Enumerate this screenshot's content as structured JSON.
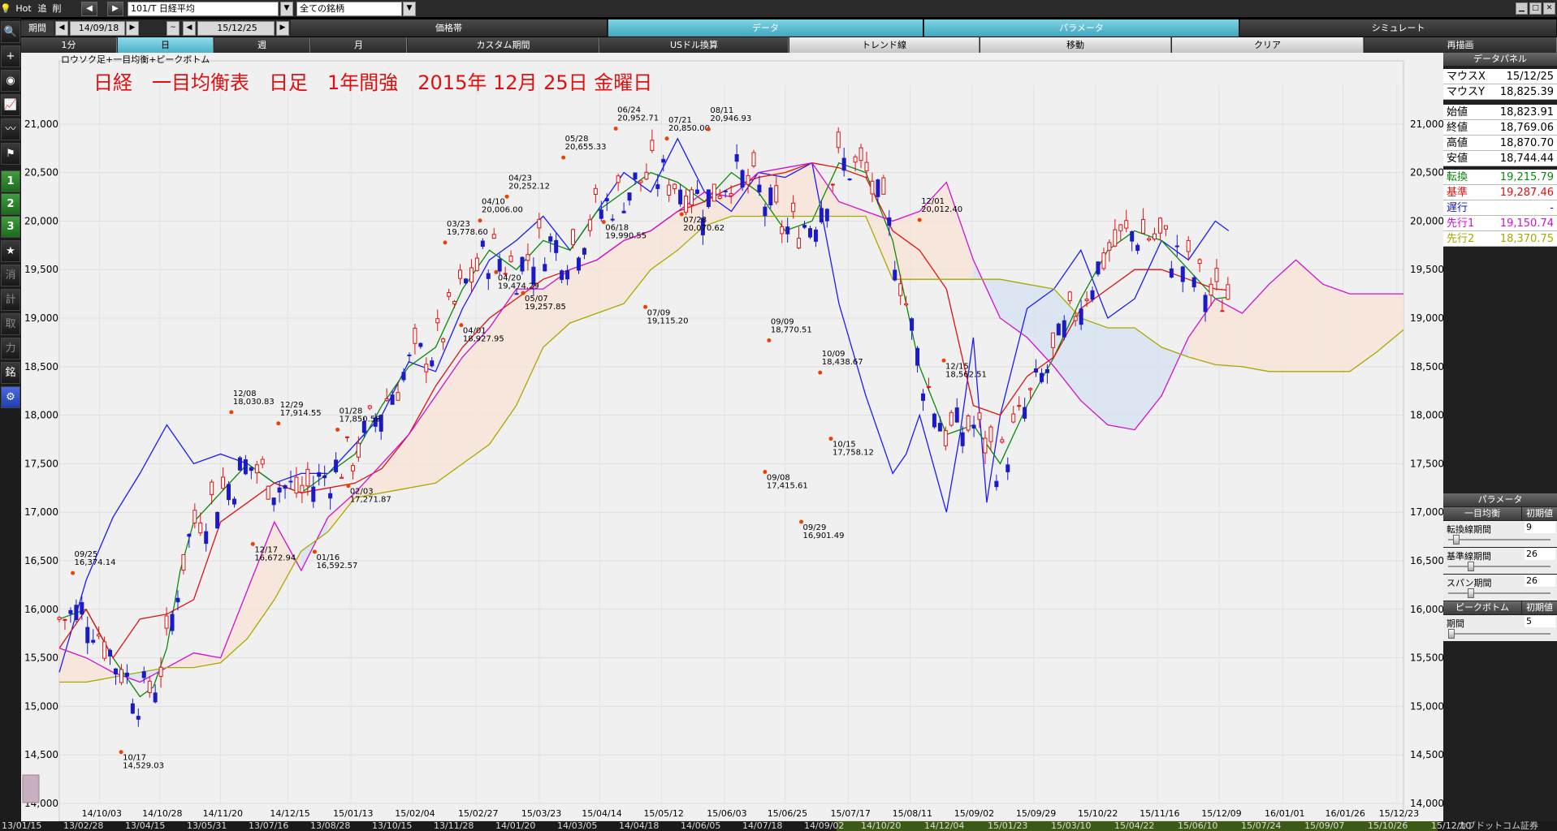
{
  "toolbar": {
    "hot": "Hot",
    "add": "追",
    "del": "削",
    "prev_icon": "◀",
    "next_icon": "▶",
    "symbol": "101/T 日経平均",
    "universe": "全ての銘柄",
    "period_label": "期間",
    "date_from": "14/09/18",
    "date_tilde": "~",
    "date_to": "15/12/25"
  },
  "tabs_row1": [
    {
      "label": "価格帯",
      "active": false
    },
    {
      "label": "データ",
      "active": true
    },
    {
      "label": "パラメータ",
      "active": true
    },
    {
      "label": "シミュレート",
      "active": false
    }
  ],
  "tabs_row2": [
    {
      "label": "1分",
      "state": "light"
    },
    {
      "label": "日",
      "state": "on"
    },
    {
      "label": "週",
      "state": "light"
    },
    {
      "label": "月",
      "state": "light"
    },
    {
      "label": "カスタム期間",
      "state": "light"
    },
    {
      "label": "USドル換算",
      "state": "light"
    },
    {
      "label": "トレンド線",
      "state": "light"
    },
    {
      "label": "移動",
      "state": "light"
    },
    {
      "label": "クリア",
      "state": "light"
    },
    {
      "label": "再描画",
      "state": "dark"
    }
  ],
  "sidebar": [
    {
      "name": "search-icon",
      "glyph": "🔍"
    },
    {
      "name": "crosshair-icon",
      "glyph": "+"
    },
    {
      "name": "camera-icon",
      "glyph": "◉"
    },
    {
      "name": "line-chart-icon",
      "glyph": "📈"
    },
    {
      "name": "multi-line-icon",
      "glyph": "〰"
    },
    {
      "name": "flag-icon",
      "glyph": "⚑"
    },
    {
      "name": "slot-1-button",
      "glyph": "1"
    },
    {
      "name": "slot-2-button",
      "glyph": "2"
    },
    {
      "name": "slot-3-button",
      "glyph": "3"
    },
    {
      "name": "star-icon",
      "glyph": "★"
    },
    {
      "name": "erase-button",
      "glyph": "消"
    },
    {
      "name": "mode-button",
      "glyph": "計"
    },
    {
      "name": "take-button",
      "glyph": "取"
    },
    {
      "name": "force-button",
      "glyph": "力"
    },
    {
      "name": "issue-button",
      "glyph": "銘"
    },
    {
      "name": "gear-icon",
      "glyph": "⚙"
    }
  ],
  "data_panel": {
    "title": "データパネル",
    "rows": [
      {
        "k": "マウスX",
        "v": "15/12/25",
        "color": "#000000"
      },
      {
        "k": "マウスY",
        "v": "18,825.39",
        "color": "#000000"
      },
      {
        "k": "始値",
        "v": "18,823.91",
        "color": "#000000"
      },
      {
        "k": "終値",
        "v": "18,769.06",
        "color": "#000000"
      },
      {
        "k": "高値",
        "v": "18,870.70",
        "color": "#000000"
      },
      {
        "k": "安値",
        "v": "18,744.44",
        "color": "#000000"
      },
      {
        "k": "転換",
        "v": "19,215.79",
        "color": "#0a8a0a"
      },
      {
        "k": "基準",
        "v": "19,287.46",
        "color": "#e01010"
      },
      {
        "k": "遅行",
        "v": "-",
        "color": "#1010e0"
      },
      {
        "k": "先行1",
        "v": "19,150.74",
        "color": "#d010d0"
      },
      {
        "k": "先行2",
        "v": "18,370.75",
        "color": "#a8a800"
      }
    ]
  },
  "params": {
    "title": "パラメータ",
    "section": "一目均衡",
    "reset": "初期値",
    "items": [
      {
        "label": "転換線期間",
        "value": "9",
        "level": 0.05
      },
      {
        "label": "基準線期間",
        "value": "26",
        "level": 0.2
      },
      {
        "label": "スパン期間",
        "value": "26",
        "level": 0.2
      }
    ],
    "section2": "ピークボトム",
    "items2": [
      {
        "label": "期間",
        "value": "5",
        "level": 0.0
      }
    ]
  },
  "bottom_dates_left": [
    "13/01/15",
    "13/02/28",
    "13/04/15",
    "13/05/31",
    "13/07/16",
    "13/08/28",
    "13/10/15",
    "13/11/28",
    "14/01/20",
    "14/03/05",
    "14/04/18",
    "14/06/05",
    "14/07/18",
    "14/09/02"
  ],
  "bottom_dates_right": [
    "14/10/20",
    "14/12/04",
    "15/01/23",
    "15/03/10",
    "15/04/22",
    "15/06/10",
    "15/07/24",
    "15/09/07",
    "15/10/26",
    "15/12/10"
  ],
  "bottom_status": "カブドットコム証券",
  "chart_data": {
    "type": "line",
    "title": "日経　一目均衡表　日足　1年間強　2015年 12月 25日 金曜日",
    "legend_text": "ロウソク足+一目均衡+ピークボトム",
    "ylim": [
      14000,
      21400
    ],
    "y_ticks": [
      14000,
      14500,
      15000,
      15500,
      16000,
      16500,
      17000,
      17500,
      18000,
      18500,
      19000,
      19500,
      20000,
      20500,
      21000
    ],
    "y_tick_labels": [
      "14,000",
      "14,500",
      "15,000",
      "15,500",
      "16,000",
      "16,500",
      "17,000",
      "17,500",
      "18,000",
      "18,500",
      "19,000",
      "19,500",
      "20,000",
      "20,500",
      "21,000"
    ],
    "x_ticks": [
      {
        "label": "14/10/03",
        "x": 0.03
      },
      {
        "label": "14/10/28",
        "x": 0.075
      },
      {
        "label": "14/11/20",
        "x": 0.12
      },
      {
        "label": "14/12/15",
        "x": 0.17
      },
      {
        "label": "15/01/13",
        "x": 0.217
      },
      {
        "label": "15/02/04",
        "x": 0.263
      },
      {
        "label": "15/02/27",
        "x": 0.31
      },
      {
        "label": "15/03/23",
        "x": 0.357
      },
      {
        "label": "15/04/14",
        "x": 0.402
      },
      {
        "label": "15/05/12",
        "x": 0.448
      },
      {
        "label": "15/06/03",
        "x": 0.495
      },
      {
        "label": "15/06/25",
        "x": 0.54
      },
      {
        "label": "15/07/17",
        "x": 0.587
      },
      {
        "label": "15/08/11",
        "x": 0.633
      },
      {
        "label": "15/09/02",
        "x": 0.679
      },
      {
        "label": "15/09/29",
        "x": 0.725
      },
      {
        "label": "15/10/22",
        "x": 0.771
      },
      {
        "label": "15/11/16",
        "x": 0.817
      },
      {
        "label": "15/12/09",
        "x": 0.863
      },
      {
        "label": "16/01/01",
        "x": 0.91
      },
      {
        "label": "16/01/26",
        "x": 0.955
      },
      {
        "label": "15/12/23",
        "x": 0.995
      }
    ],
    "series": [
      {
        "name": "遅行",
        "color": "#1a1aff",
        "x": [
          0.0,
          0.02,
          0.04,
          0.06,
          0.08,
          0.1,
          0.12,
          0.14,
          0.16,
          0.18,
          0.2,
          0.22,
          0.24,
          0.26,
          0.28,
          0.3,
          0.32,
          0.34,
          0.36,
          0.38,
          0.4,
          0.42,
          0.44,
          0.46,
          0.48,
          0.5,
          0.52,
          0.54,
          0.56,
          0.58,
          0.6,
          0.62,
          0.63,
          0.64,
          0.65,
          0.66,
          0.67,
          0.68,
          0.69,
          0.7,
          0.72,
          0.74,
          0.76,
          0.78,
          0.8,
          0.82,
          0.84,
          0.86,
          0.87
        ],
        "values": [
          15350,
          16300,
          16950,
          17400,
          17900,
          17500,
          17600,
          17500,
          17300,
          17400,
          17400,
          17700,
          18000,
          18550,
          18450,
          19100,
          19600,
          19800,
          20050,
          19700,
          20100,
          20500,
          20300,
          20850,
          20300,
          20100,
          20500,
          20450,
          20600,
          19150,
          18200,
          17400,
          17600,
          18000,
          17500,
          17000,
          17800,
          18800,
          17100,
          18000,
          19100,
          19300,
          19700,
          19000,
          19200,
          19800,
          19600,
          20000,
          19900
        ]
      },
      {
        "name": "転換",
        "color": "#0a8a0a",
        "x": [
          0.0,
          0.02,
          0.04,
          0.06,
          0.07,
          0.08,
          0.09,
          0.1,
          0.12,
          0.14,
          0.16,
          0.18,
          0.2,
          0.22,
          0.24,
          0.26,
          0.28,
          0.3,
          0.32,
          0.34,
          0.36,
          0.38,
          0.4,
          0.42,
          0.44,
          0.46,
          0.48,
          0.5,
          0.52,
          0.54,
          0.56,
          0.58,
          0.6,
          0.62,
          0.64,
          0.66,
          0.68,
          0.7,
          0.72,
          0.74,
          0.76,
          0.78,
          0.8,
          0.82,
          0.84,
          0.86,
          0.87
        ],
        "values": [
          15900,
          16000,
          15500,
          15100,
          15200,
          15600,
          16400,
          16900,
          17200,
          17500,
          17300,
          17200,
          17400,
          17600,
          18100,
          18500,
          18700,
          19300,
          19700,
          19500,
          19800,
          19700,
          20100,
          20300,
          20500,
          20400,
          20200,
          20500,
          20300,
          19900,
          20000,
          20600,
          20500,
          19800,
          18500,
          17800,
          17900,
          17500,
          18100,
          18600,
          19200,
          19700,
          19900,
          19800,
          19500,
          19200,
          19216
        ]
      },
      {
        "name": "基準",
        "color": "#e01010",
        "x": [
          0.0,
          0.02,
          0.04,
          0.06,
          0.08,
          0.1,
          0.12,
          0.14,
          0.16,
          0.18,
          0.2,
          0.22,
          0.24,
          0.26,
          0.28,
          0.3,
          0.32,
          0.34,
          0.36,
          0.38,
          0.4,
          0.42,
          0.44,
          0.46,
          0.48,
          0.5,
          0.52,
          0.54,
          0.56,
          0.58,
          0.6,
          0.62,
          0.64,
          0.66,
          0.68,
          0.7,
          0.72,
          0.74,
          0.76,
          0.78,
          0.8,
          0.82,
          0.84,
          0.86,
          0.87
        ],
        "values": [
          15600,
          16000,
          15500,
          15900,
          15950,
          16100,
          16900,
          17100,
          17300,
          17200,
          17250,
          17300,
          17450,
          17800,
          18300,
          18700,
          19000,
          19200,
          19400,
          19500,
          19600,
          19800,
          19900,
          20100,
          20200,
          20350,
          20450,
          20500,
          20600,
          20550,
          20450,
          19900,
          19700,
          19300,
          18100,
          18000,
          18400,
          18600,
          19100,
          19300,
          19500,
          19500,
          19400,
          19300,
          19287
        ]
      },
      {
        "name": "先行1",
        "color": "#d010d0",
        "x": [
          0.0,
          0.02,
          0.04,
          0.06,
          0.08,
          0.1,
          0.12,
          0.14,
          0.16,
          0.18,
          0.2,
          0.22,
          0.24,
          0.26,
          0.28,
          0.3,
          0.32,
          0.34,
          0.36,
          0.38,
          0.4,
          0.42,
          0.44,
          0.46,
          0.48,
          0.5,
          0.52,
          0.54,
          0.56,
          0.58,
          0.6,
          0.62,
          0.64,
          0.66,
          0.68,
          0.7,
          0.72,
          0.74,
          0.76,
          0.78,
          0.8,
          0.82,
          0.84,
          0.86,
          0.88,
          0.9,
          0.92,
          0.94,
          0.96,
          0.98,
          1.0
        ],
        "values": [
          15600,
          15500,
          15350,
          15250,
          15400,
          15550,
          15500,
          16200,
          16900,
          16400,
          16950,
          17200,
          17500,
          17800,
          18200,
          18600,
          18900,
          19300,
          19300,
          19500,
          19600,
          19800,
          19900,
          20100,
          20300,
          20250,
          20500,
          20550,
          20600,
          20200,
          20100,
          20000,
          20100,
          20400,
          19600,
          19000,
          18800,
          18500,
          18150,
          17900,
          17850,
          18200,
          18800,
          19200,
          19050,
          19350,
          19600,
          19350,
          19250,
          19250,
          19250
        ]
      },
      {
        "name": "先行2",
        "color": "#a8a800",
        "x": [
          0.0,
          0.02,
          0.04,
          0.06,
          0.08,
          0.1,
          0.12,
          0.14,
          0.16,
          0.18,
          0.2,
          0.22,
          0.24,
          0.26,
          0.28,
          0.3,
          0.32,
          0.34,
          0.36,
          0.38,
          0.4,
          0.42,
          0.44,
          0.46,
          0.48,
          0.5,
          0.52,
          0.54,
          0.56,
          0.58,
          0.6,
          0.62,
          0.64,
          0.66,
          0.68,
          0.7,
          0.72,
          0.74,
          0.76,
          0.78,
          0.8,
          0.82,
          0.84,
          0.86,
          0.88,
          0.9,
          0.92,
          0.94,
          0.96,
          0.98,
          1.0
        ],
        "values": [
          15250,
          15250,
          15300,
          15350,
          15400,
          15400,
          15450,
          15700,
          16100,
          16600,
          16800,
          17150,
          17200,
          17250,
          17300,
          17500,
          17700,
          18100,
          18700,
          18950,
          19050,
          19150,
          19500,
          19700,
          19950,
          20050,
          20050,
          20050,
          20050,
          20050,
          20050,
          19400,
          19400,
          19400,
          19400,
          19400,
          19350,
          19300,
          19000,
          18900,
          18900,
          18700,
          18600,
          18520,
          18500,
          18450,
          18450,
          18450,
          18450,
          18650,
          18880
        ]
      }
    ],
    "peaks": [
      {
        "label": "09/25\n16,374.14",
        "x": 0.01,
        "y": 16374,
        "up": true
      },
      {
        "label": "10/17\n14,529.03",
        "x": 0.046,
        "y": 14529,
        "up": false
      },
      {
        "label": "12/08\n18,030.83",
        "x": 0.128,
        "y": 18031,
        "up": true
      },
      {
        "label": "12/17\n16,672.94",
        "x": 0.144,
        "y": 16673,
        "up": false
      },
      {
        "label": "12/29\n17,914.55",
        "x": 0.163,
        "y": 17915,
        "up": true
      },
      {
        "label": "01/16\n16,592.57",
        "x": 0.19,
        "y": 16593,
        "up": false
      },
      {
        "label": "01/28\n17,850.58",
        "x": 0.207,
        "y": 17851,
        "up": true
      },
      {
        "label": "02/03\n17,271.87",
        "x": 0.215,
        "y": 17272,
        "up": false
      },
      {
        "label": "03/23\n19,778.60",
        "x": 0.287,
        "y": 19779,
        "up": true
      },
      {
        "label": "04/01\n18,927.95",
        "x": 0.299,
        "y": 18928,
        "up": false
      },
      {
        "label": "04/10\n20,006.00",
        "x": 0.313,
        "y": 20006,
        "up": true
      },
      {
        "label": "04/20\n19,474.29",
        "x": 0.325,
        "y": 19474,
        "up": false
      },
      {
        "label": "04/23\n20,252.12",
        "x": 0.333,
        "y": 20252,
        "up": true
      },
      {
        "label": "05/07\n19,257.85",
        "x": 0.345,
        "y": 19258,
        "up": false
      },
      {
        "label": "05/28\n20,655.33",
        "x": 0.375,
        "y": 20655,
        "up": true
      },
      {
        "label": "06/18\n19,990.55",
        "x": 0.405,
        "y": 19991,
        "up": false
      },
      {
        "label": "06/24\n20,952.71",
        "x": 0.414,
        "y": 20953,
        "up": true
      },
      {
        "label": "07/09\n19,115.20",
        "x": 0.436,
        "y": 19115,
        "up": false
      },
      {
        "label": "07/21\n20,850.00",
        "x": 0.452,
        "y": 20850,
        "up": true
      },
      {
        "label": "07/28\n20,070.62",
        "x": 0.463,
        "y": 20071,
        "up": false
      },
      {
        "label": "08/11\n20,946.93",
        "x": 0.483,
        "y": 20947,
        "up": true
      },
      {
        "label": "09/08\n17,415.61",
        "x": 0.525,
        "y": 17416,
        "up": false
      },
      {
        "label": "09/09\n18,770.51",
        "x": 0.528,
        "y": 18771,
        "up": true
      },
      {
        "label": "09/29\n16,901.49",
        "x": 0.552,
        "y": 16901,
        "up": false
      },
      {
        "label": "10/09\n18,438.67",
        "x": 0.566,
        "y": 18439,
        "up": true
      },
      {
        "label": "10/15\n17,758.12",
        "x": 0.574,
        "y": 17758,
        "up": false
      },
      {
        "label": "12/01\n20,012.40",
        "x": 0.64,
        "y": 20012,
        "up": true
      },
      {
        "label": "12/15\n18,562.51",
        "x": 0.658,
        "y": 18563,
        "up": false
      }
    ]
  }
}
